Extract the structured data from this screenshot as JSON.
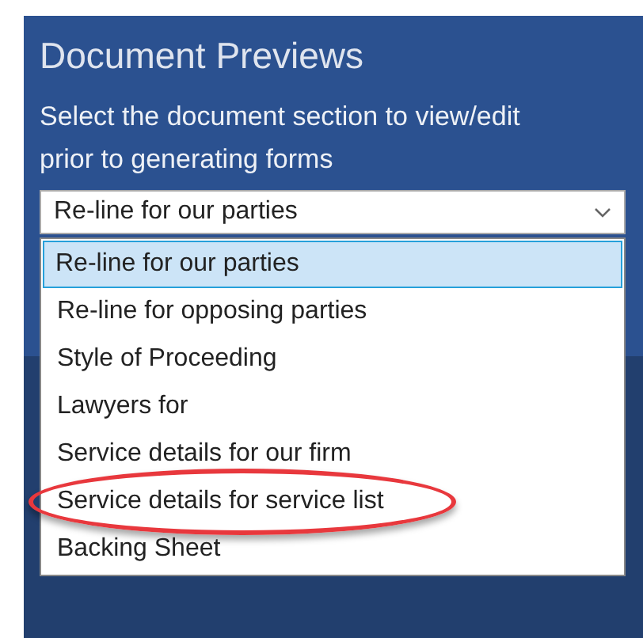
{
  "panel": {
    "title": "Document Previews",
    "instructions": "Select the document section to view/edit prior to generating forms"
  },
  "dropdown": {
    "value": "Re-line for our parties",
    "expanded": true
  },
  "options": [
    {
      "label": "Re-line for our parties",
      "selected": true,
      "circled": false
    },
    {
      "label": "Re-line for opposing parties",
      "selected": false,
      "circled": false
    },
    {
      "label": "Style of Proceeding",
      "selected": false,
      "circled": false
    },
    {
      "label": "Lawyers for",
      "selected": false,
      "circled": false
    },
    {
      "label": "Service details for our firm",
      "selected": false,
      "circled": false
    },
    {
      "label": "Service details for service list",
      "selected": false,
      "circled": true
    },
    {
      "label": "Backing Sheet",
      "selected": false,
      "circled": false
    }
  ]
}
